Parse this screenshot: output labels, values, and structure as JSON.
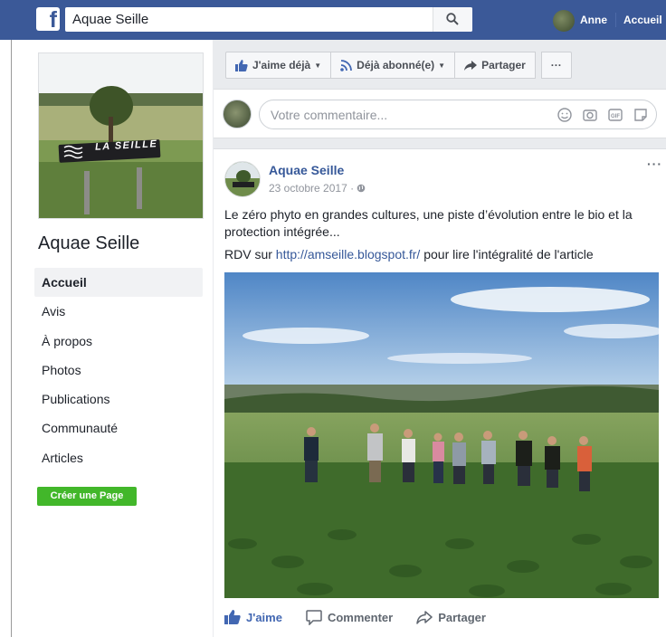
{
  "topbar": {
    "logo": "f",
    "search_value": "Aquae Seille",
    "user_name": "Anne",
    "home_label": "Accueil"
  },
  "sidebar": {
    "cover_sign": "LA SEILLE",
    "page_name": "Aquae Seille",
    "items": [
      {
        "label": "Accueil"
      },
      {
        "label": "Avis"
      },
      {
        "label": "À propos"
      },
      {
        "label": "Photos"
      },
      {
        "label": "Publications"
      },
      {
        "label": "Communauté"
      },
      {
        "label": "Articles"
      }
    ],
    "create_page": "Créer une Page"
  },
  "actions": {
    "like": "J'aime déjà",
    "follow": "Déjà abonné(e)",
    "share": "Partager",
    "more": "···"
  },
  "composer": {
    "placeholder": "Votre commentaire..."
  },
  "post": {
    "author": "Aquae Seille",
    "date": "23 octobre 2017 · ",
    "more": "···",
    "text": "Le zéro phyto en grandes cultures, une piste d’évolution entre le bio et la protection intégrée...",
    "rdv_prefix": "RDV sur ",
    "link": "http://amseille.blogspot.fr/",
    "rdv_suffix": " pour lire l'intégralité de l'article",
    "like": "J'aime",
    "comment": "Commenter",
    "share": "Partager"
  },
  "colors": {
    "brand": "#3b5998",
    "link": "#365899",
    "create_button": "#42b72a"
  }
}
